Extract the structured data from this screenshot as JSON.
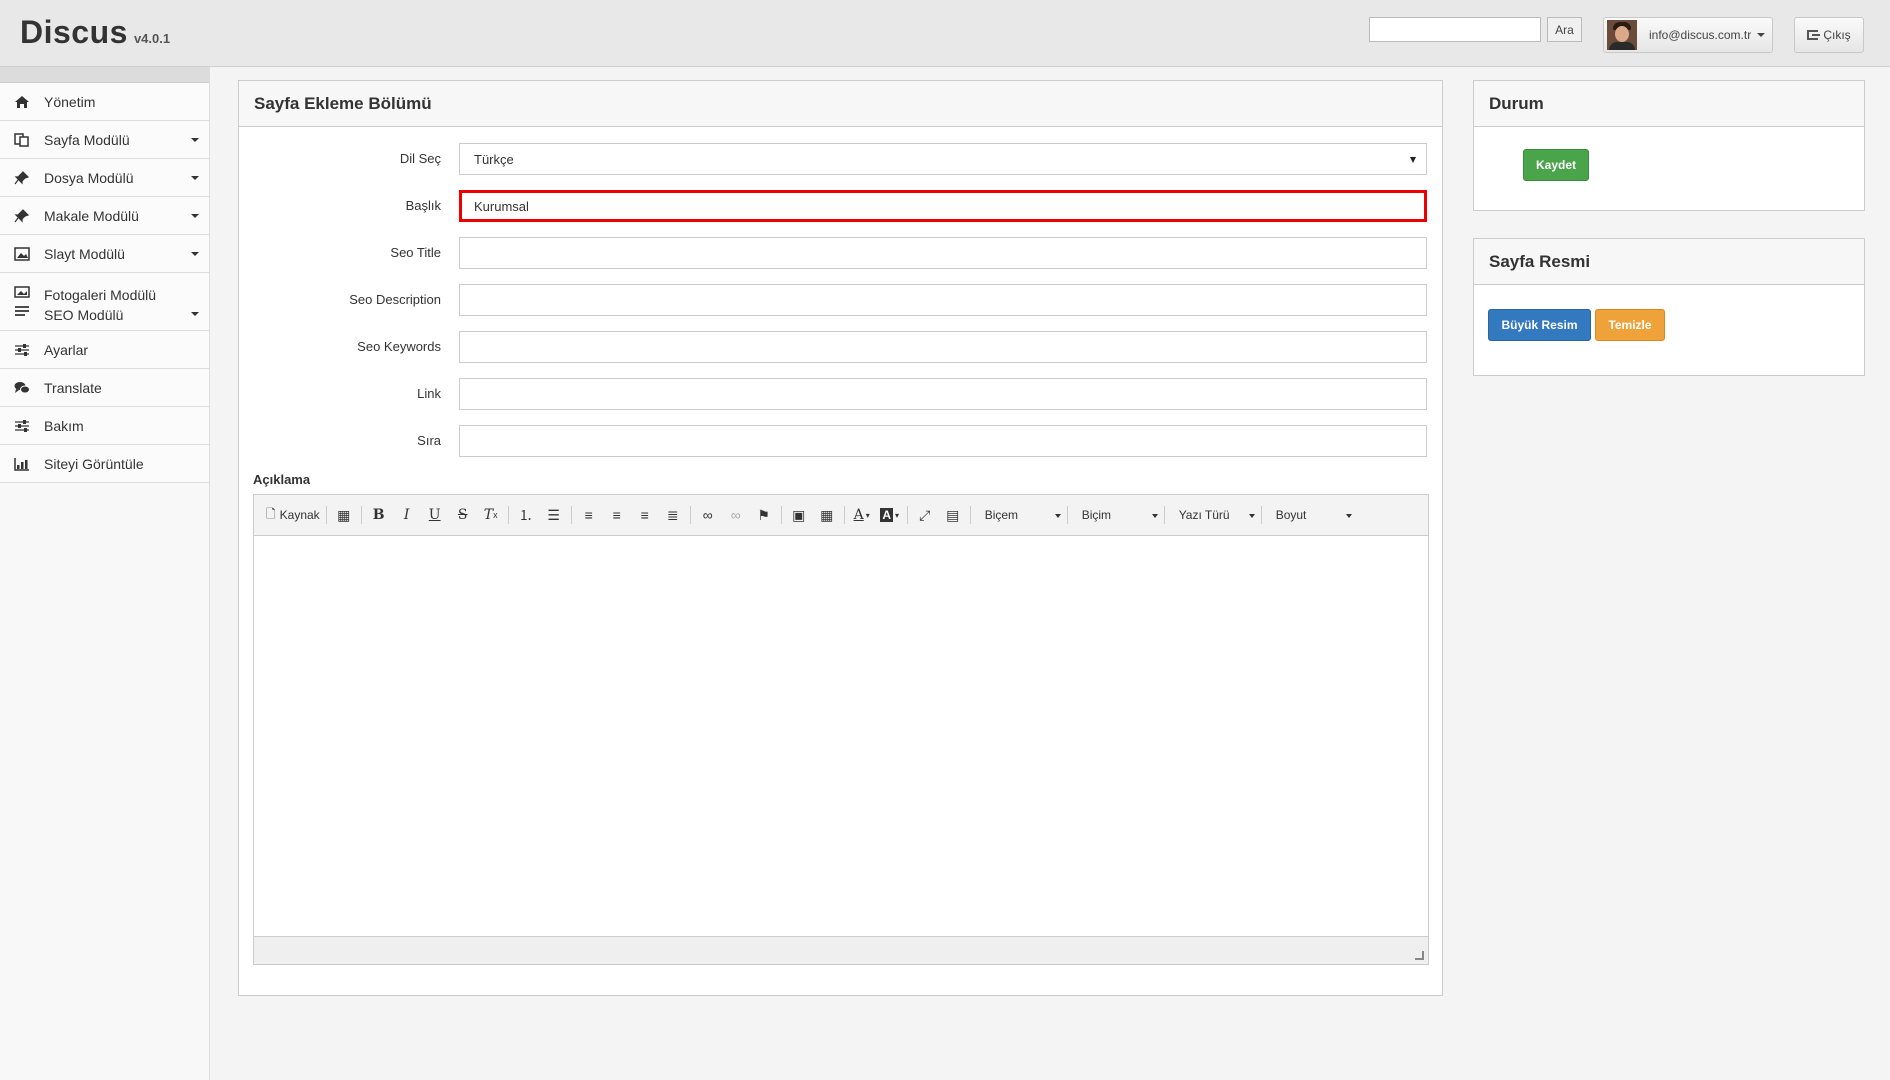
{
  "app": {
    "name": "Discus",
    "version": "v4.0.1"
  },
  "header": {
    "search_button": "Ara",
    "user_email": "info@discus.com.tr",
    "logout_label": "Çıkış"
  },
  "sidebar": {
    "items": [
      {
        "label": "Yönetim",
        "icon": "home-icon"
      },
      {
        "label": "Sayfa Modülü",
        "icon": "pages-icon"
      },
      {
        "label": "Dosya Modülü",
        "icon": "pin-icon"
      },
      {
        "label": "Makale Modülü",
        "icon": "pin-icon"
      },
      {
        "label": "Slayt Modülü",
        "icon": "slide-icon"
      },
      {
        "label": "Fotogaleri Modülü",
        "icon": "gallery-icon"
      },
      {
        "label": "SEO Modülü",
        "icon": "list-icon"
      },
      {
        "label": "Ayarlar",
        "icon": "sliders-icon"
      },
      {
        "label": "Translate",
        "icon": "chat-icon"
      },
      {
        "label": "Bakım",
        "icon": "sliders-icon"
      },
      {
        "label": "Siteyi Görüntüle",
        "icon": "chart-icon"
      }
    ]
  },
  "main": {
    "title": "Sayfa Ekleme Bölümü",
    "fields": [
      {
        "label": "Dil Seç",
        "value": "Türkçe",
        "type": "select"
      },
      {
        "label": "Başlık",
        "value": "Kurumsal",
        "type": "text"
      },
      {
        "label": "Seo Title",
        "value": "",
        "type": "text"
      },
      {
        "label": "Seo Description",
        "value": "",
        "type": "text"
      },
      {
        "label": "Seo Keywords",
        "value": "",
        "type": "text"
      },
      {
        "label": "Link",
        "value": "",
        "type": "text"
      },
      {
        "label": "Sıra",
        "value": "",
        "type": "text"
      }
    ],
    "description_label": "Açıklama",
    "editor": {
      "source_label": "Kaynak",
      "combos": [
        "Biçem",
        "Biçim",
        "Yazı Türü",
        "Boyut"
      ]
    }
  },
  "status_panel": {
    "title": "Durum",
    "save_label": "Kaydet"
  },
  "image_panel": {
    "title": "Sayfa Resmi",
    "big_image_label": "Büyük Resim",
    "clear_label": "Temizle"
  },
  "colors": {
    "highlight": "#ee0000",
    "save": "#4aa44a",
    "big_image": "#3379c0",
    "clear": "#f0a23a"
  }
}
